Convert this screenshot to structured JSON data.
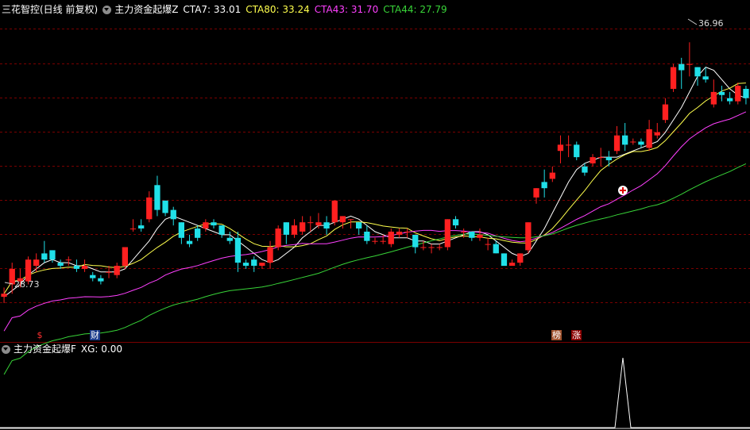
{
  "header": {
    "stock_title": "三花智控(日线 前复权)",
    "indicator_name": "主力资金起爆Z",
    "indicators": [
      {
        "label": "CTA7: 33.01",
        "color": "#ffffff"
      },
      {
        "label": "CTA80: 33.24",
        "color": "#ffff4d"
      },
      {
        "label": "CTA43: 31.70",
        "color": "#ff40ff"
      },
      {
        "label": "CTA44: 27.79",
        "color": "#38d438"
      }
    ]
  },
  "price_labels": {
    "high": "36.96",
    "low": "28.73"
  },
  "event_tags": {
    "dollar": "$",
    "cai": "财",
    "bang": "榜",
    "zhang": "涨"
  },
  "sub_header": {
    "indicator_name": "主力资金起爆F",
    "xg_label": "XG: 0.00"
  },
  "colors": {
    "up": "#ff2020",
    "down": "#20e0e8",
    "grid": "#7a0000",
    "ma_short": "#ffffff",
    "ma_mid": "#ffff4d",
    "ma_long": "#ff40ff",
    "ma_xlong": "#38d438"
  },
  "chart_data": {
    "type": "candlestick",
    "ylim": [
      27.5,
      37.8
    ],
    "candles": [
      [
        28.8,
        29.1,
        28.6,
        28.9
      ],
      [
        29.2,
        29.9,
        28.9,
        29.7
      ],
      [
        29.3,
        29.7,
        29.1,
        29.4
      ],
      [
        29.3,
        30.1,
        29.2,
        30.0
      ],
      [
        29.8,
        30.2,
        29.6,
        30.0
      ],
      [
        30.2,
        30.6,
        29.9,
        30.0
      ],
      [
        30.3,
        30.3,
        29.9,
        30.0
      ],
      [
        29.9,
        30.0,
        29.7,
        29.8
      ],
      [
        30.0,
        30.1,
        29.8,
        30.0
      ],
      [
        29.8,
        30.0,
        29.6,
        29.7
      ],
      [
        29.7,
        30.0,
        29.6,
        29.8
      ],
      [
        29.5,
        29.6,
        29.3,
        29.4
      ],
      [
        29.4,
        29.5,
        29.2,
        29.3
      ],
      [
        29.6,
        29.8,
        29.4,
        29.6
      ],
      [
        29.5,
        29.9,
        29.4,
        29.8
      ],
      [
        29.8,
        30.4,
        29.7,
        30.4
      ],
      [
        31.0,
        31.3,
        30.9,
        31.0
      ],
      [
        31.1,
        31.3,
        30.9,
        31.0
      ],
      [
        31.3,
        32.2,
        31.2,
        32.0
      ],
      [
        32.4,
        32.7,
        31.4,
        31.6
      ],
      [
        31.9,
        31.9,
        31.4,
        31.5
      ],
      [
        31.6,
        31.7,
        31.1,
        31.3
      ],
      [
        31.2,
        31.2,
        30.5,
        30.7
      ],
      [
        30.6,
        30.8,
        30.4,
        30.5
      ],
      [
        31.0,
        31.1,
        30.6,
        30.7
      ],
      [
        31.0,
        31.3,
        30.9,
        31.2
      ],
      [
        31.2,
        31.3,
        31.0,
        31.1
      ],
      [
        31.1,
        31.1,
        30.7,
        30.8
      ],
      [
        30.7,
        30.9,
        30.5,
        30.6
      ],
      [
        30.7,
        30.9,
        29.6,
        29.9
      ],
      [
        29.9,
        30.0,
        29.7,
        29.8
      ],
      [
        30.0,
        30.1,
        29.6,
        29.8
      ],
      [
        29.8,
        29.9,
        29.7,
        29.9
      ],
      [
        29.9,
        30.6,
        29.7,
        30.4
      ],
      [
        30.4,
        31.1,
        30.3,
        31.0
      ],
      [
        31.2,
        31.2,
        30.5,
        30.8
      ],
      [
        30.8,
        31.3,
        30.7,
        31.1
      ],
      [
        30.9,
        31.4,
        30.8,
        31.2
      ],
      [
        31.2,
        31.4,
        30.9,
        31.2
      ],
      [
        31.1,
        31.5,
        31.0,
        31.2
      ],
      [
        31.2,
        31.4,
        30.8,
        31.0
      ],
      [
        31.2,
        31.9,
        31.1,
        31.9
      ],
      [
        31.2,
        31.4,
        31.0,
        31.4
      ],
      [
        31.3,
        31.3,
        31.0,
        31.3
      ],
      [
        31.2,
        31.2,
        30.8,
        31.0
      ],
      [
        30.9,
        31.1,
        30.5,
        30.6
      ],
      [
        30.6,
        30.7,
        30.5,
        30.6
      ],
      [
        30.6,
        30.8,
        30.5,
        30.6
      ],
      [
        30.5,
        31.0,
        30.4,
        30.9
      ],
      [
        30.8,
        31.0,
        30.7,
        30.9
      ],
      [
        30.9,
        31.0,
        30.7,
        30.9
      ],
      [
        30.8,
        30.8,
        30.2,
        30.4
      ],
      [
        30.4,
        30.6,
        30.3,
        30.4
      ],
      [
        30.4,
        30.5,
        30.2,
        30.4
      ],
      [
        30.4,
        30.5,
        30.3,
        30.4
      ],
      [
        30.4,
        31.3,
        30.3,
        31.3
      ],
      [
        31.3,
        31.4,
        31.0,
        31.1
      ],
      [
        30.9,
        31.0,
        30.7,
        30.9
      ],
      [
        30.9,
        30.9,
        30.6,
        30.7
      ],
      [
        30.7,
        31.0,
        30.6,
        30.8
      ],
      [
        30.5,
        30.7,
        30.3,
        30.5
      ],
      [
        30.5,
        30.6,
        30.2,
        30.2
      ],
      [
        30.2,
        30.2,
        29.8,
        29.8
      ],
      [
        29.8,
        30.0,
        29.8,
        29.9
      ],
      [
        29.9,
        30.2,
        29.8,
        30.2
      ],
      [
        30.3,
        31.2,
        30.2,
        31.2
      ],
      [
        32.0,
        32.3,
        31.8,
        32.3
      ],
      [
        32.5,
        32.9,
        32.0,
        32.3
      ],
      [
        32.6,
        33.0,
        32.5,
        32.8
      ],
      [
        33.5,
        34.0,
        33.1,
        33.7
      ],
      [
        33.7,
        34.0,
        33.3,
        33.7
      ],
      [
        33.7,
        33.8,
        33.2,
        33.3
      ],
      [
        33.0,
        33.1,
        32.7,
        32.8
      ],
      [
        33.1,
        33.4,
        33.0,
        33.3
      ],
      [
        33.3,
        33.6,
        33.0,
        33.3
      ],
      [
        33.3,
        33.5,
        33.0,
        33.2
      ],
      [
        33.5,
        34.3,
        33.4,
        34.0
      ],
      [
        34.0,
        34.4,
        33.5,
        33.7
      ],
      [
        33.8,
        33.9,
        33.7,
        33.8
      ],
      [
        33.8,
        33.9,
        33.6,
        33.7
      ],
      [
        33.6,
        34.5,
        33.5,
        34.2
      ],
      [
        34.0,
        34.4,
        33.9,
        34.1
      ],
      [
        34.5,
        35.2,
        34.4,
        35.0
      ],
      [
        35.5,
        36.3,
        35.4,
        36.2
      ],
      [
        36.3,
        36.5,
        35.5,
        36.1
      ],
      [
        36.3,
        37.0,
        35.9,
        36.3
      ],
      [
        36.2,
        36.2,
        35.6,
        35.9
      ],
      [
        35.9,
        36.2,
        35.7,
        35.8
      ],
      [
        35.0,
        35.8,
        34.9,
        35.4
      ],
      [
        35.4,
        35.6,
        35.1,
        35.3
      ],
      [
        35.2,
        35.4,
        35.0,
        35.1
      ],
      [
        35.1,
        35.7,
        35.0,
        35.6
      ],
      [
        35.5,
        35.6,
        35.0,
        35.2
      ]
    ],
    "ma_short": [
      28.8,
      29.0,
      29.2,
      29.5,
      29.7,
      29.9,
      30.0,
      29.9,
      29.9,
      29.8,
      29.8,
      29.7,
      29.6,
      29.6,
      29.6,
      29.7,
      30.0,
      30.3,
      30.6,
      31.0,
      31.3,
      31.4,
      31.3,
      31.2,
      31.1,
      31.0,
      30.9,
      30.8,
      30.8,
      30.6,
      30.4,
      30.2,
      30.0,
      29.9,
      30.0,
      30.2,
      30.4,
      30.7,
      30.9,
      31.1,
      31.1,
      31.2,
      31.3,
      31.4,
      31.3,
      31.1,
      30.9,
      30.8,
      30.7,
      30.7,
      30.7,
      30.6,
      30.6,
      30.5,
      30.5,
      30.6,
      30.7,
      30.8,
      30.9,
      30.9,
      30.8,
      30.6,
      30.4,
      30.2,
      30.1,
      30.2,
      30.6,
      31.0,
      31.5,
      32.0,
      32.5,
      32.9,
      33.1,
      33.2,
      33.3,
      33.3,
      33.3,
      33.4,
      33.5,
      33.6,
      33.7,
      33.8,
      34.1,
      34.5,
      34.9,
      35.4,
      35.9,
      36.2,
      36.1,
      35.8,
      35.5,
      35.3,
      35.2
    ]
  },
  "sub_chart": {
    "spike_index": 83,
    "values_note": "XG"
  }
}
